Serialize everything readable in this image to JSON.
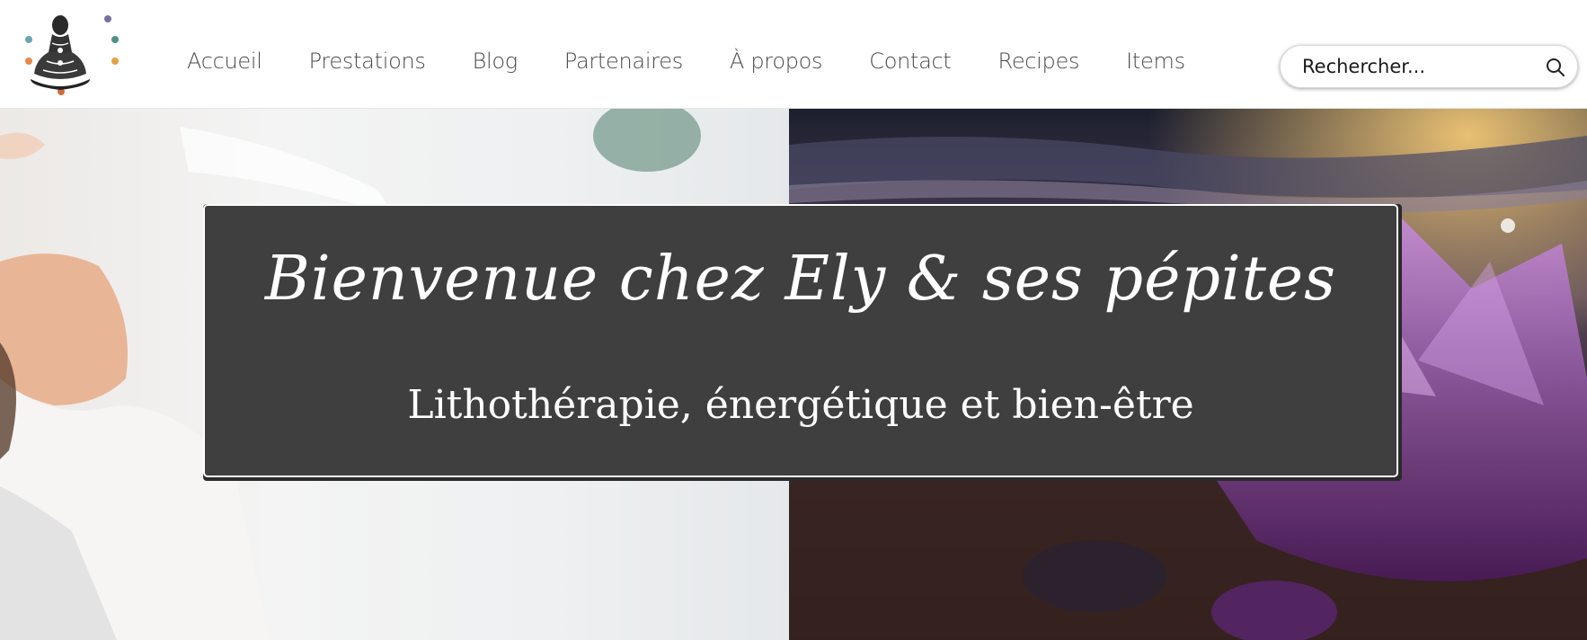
{
  "nav": {
    "items": [
      "Accueil",
      "Prestations",
      "Blog",
      "Partenaires",
      "À propos",
      "Contact",
      "Recipes",
      "Items"
    ]
  },
  "search": {
    "placeholder": "Rechercher...",
    "icon": "search-icon"
  },
  "hero": {
    "title": "Bienvenue chez Ely & ses pépites",
    "subtitle": "Lithothérapie, énergétique et bien-être"
  },
  "colors": {
    "nav_text": "#4b4b4b",
    "hero_text": "#ffffff",
    "overlay": "#505050"
  }
}
